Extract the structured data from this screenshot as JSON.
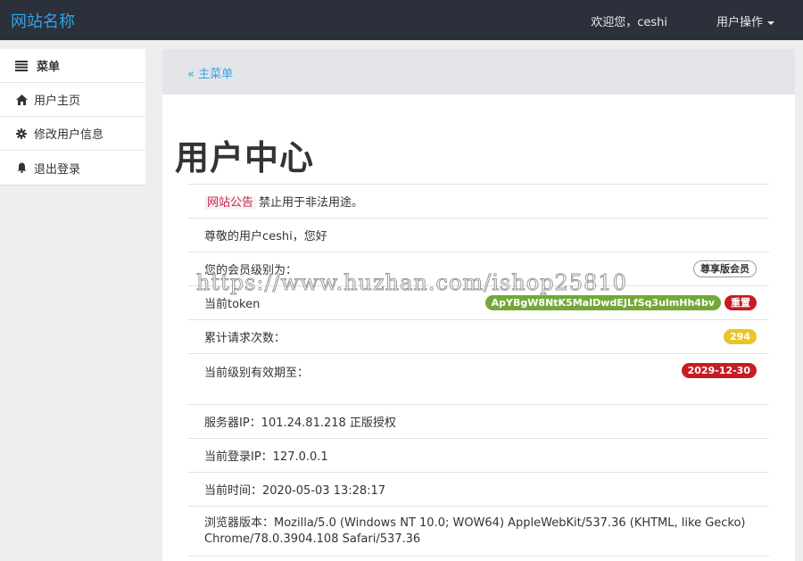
{
  "navbar": {
    "brand": "网站名称",
    "welcome": "欢迎您，ceshi",
    "user_menu": "用户操作"
  },
  "sidebar": {
    "header": "菜单",
    "items": [
      {
        "label": "用户主页",
        "icon": "home-icon"
      },
      {
        "label": "修改用户信息",
        "icon": "gear-icon"
      },
      {
        "label": "退出登录",
        "icon": "bell-icon"
      }
    ]
  },
  "breadcrumb": {
    "label": "« 主菜单"
  },
  "page": {
    "title": "用户中心"
  },
  "info": {
    "notice_tag": "网站公告",
    "notice_text": "禁止用于非法用途。",
    "greeting": "尊敬的用户ceshi，您好",
    "level_label": "您的会员级别为：",
    "level_value": "尊享版会员",
    "token_label": "当前token",
    "token_value": "ApYBgW8NtK5MaIDwdEJLfSq3ulmHh4bv",
    "token_reset": "重置",
    "requests_label": "累计请求次数：",
    "requests_value": "294",
    "expiry_label": "当前级别有效期至：",
    "expiry_value": "2029-12-30",
    "server_ip": "服务器IP：101.24.81.218 正版授权",
    "login_ip": "当前登录IP：127.0.0.1",
    "current_time": "当前时间：2020-05-03 13:28:17",
    "browser_line1": "浏览器版本：Mozilla/5.0 (Windows NT 10.0; WOW64) AppleWebKit/537.36 (KHTML, like Gecko)",
    "browser_line2": "Chrome/78.0.3904.108 Safari/537.36"
  },
  "watermark": "https://www.huzhan.com/ishop25810",
  "colors": {
    "navbar": "#2b303a",
    "brand": "#2fa4e7",
    "green": "#73a839",
    "red": "#c71c22",
    "yellow": "#e8c52b"
  }
}
